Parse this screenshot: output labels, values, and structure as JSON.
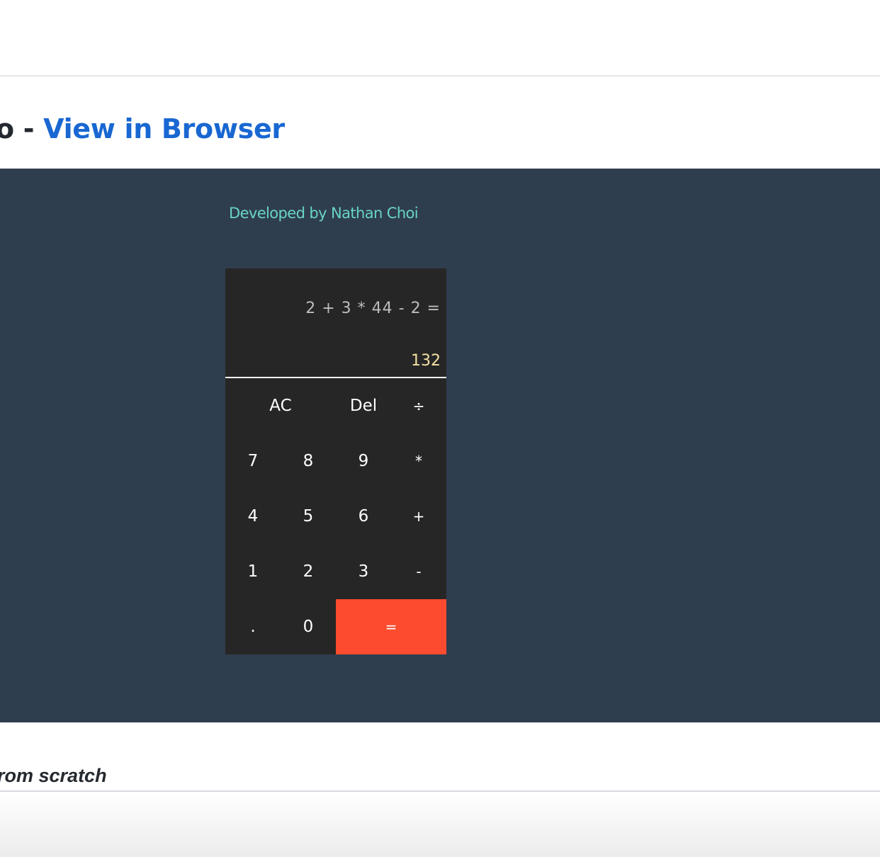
{
  "page": {
    "heading_prefix": "o - ",
    "heading_link": "View in Browser",
    "section_text": "rom scratch"
  },
  "demo": {
    "credit": "Developed by Nathan Choi",
    "background_color": "#2f3e4e"
  },
  "calculator": {
    "expression": "2 + 3 * 44 - 2 =",
    "result": "132",
    "keys": {
      "ac": "AC",
      "del": "Del",
      "divide": "÷",
      "seven": "7",
      "eight": "8",
      "nine": "9",
      "multiply": "*",
      "four": "4",
      "five": "5",
      "six": "6",
      "plus": "+",
      "one": "1",
      "two": "2",
      "three": "3",
      "minus": "-",
      "dot": ".",
      "zero": "0",
      "equals": "="
    },
    "colors": {
      "body": "#262626",
      "equals": "#fc4b2f",
      "result": "#f3e1a2",
      "credit": "#67d4c6"
    }
  }
}
